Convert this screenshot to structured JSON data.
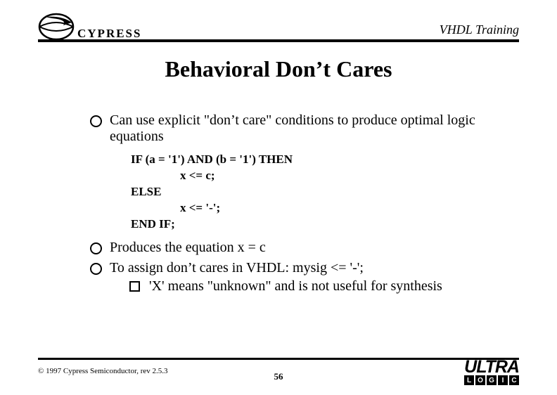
{
  "header": {
    "brand": "CYPRESS",
    "course": "VHDL Training"
  },
  "slide": {
    "title": "Behavioral Don’t Cares"
  },
  "bullets": {
    "b1": "Can use explicit \"don’t care\" conditions to produce optimal logic equations",
    "b2": "Produces the equation x = c",
    "b3": "To assign don’t cares in VHDL:  mysig <= '-';",
    "b3_sub": "'X' means \"unknown\" and is not useful for synthesis"
  },
  "code": {
    "l1": "IF (a = '1') AND (b = '1') THEN",
    "l2": "x <= c;",
    "l3": "ELSE",
    "l4": "x <= '-';",
    "l5": "END IF;"
  },
  "footer": {
    "copyright": "© 1997 Cypress Semiconductor, rev 2.5.3",
    "page": "56",
    "ultra_word": "ULTRA",
    "ultra_letters": [
      "L",
      "O",
      "G",
      "I",
      "C"
    ]
  }
}
